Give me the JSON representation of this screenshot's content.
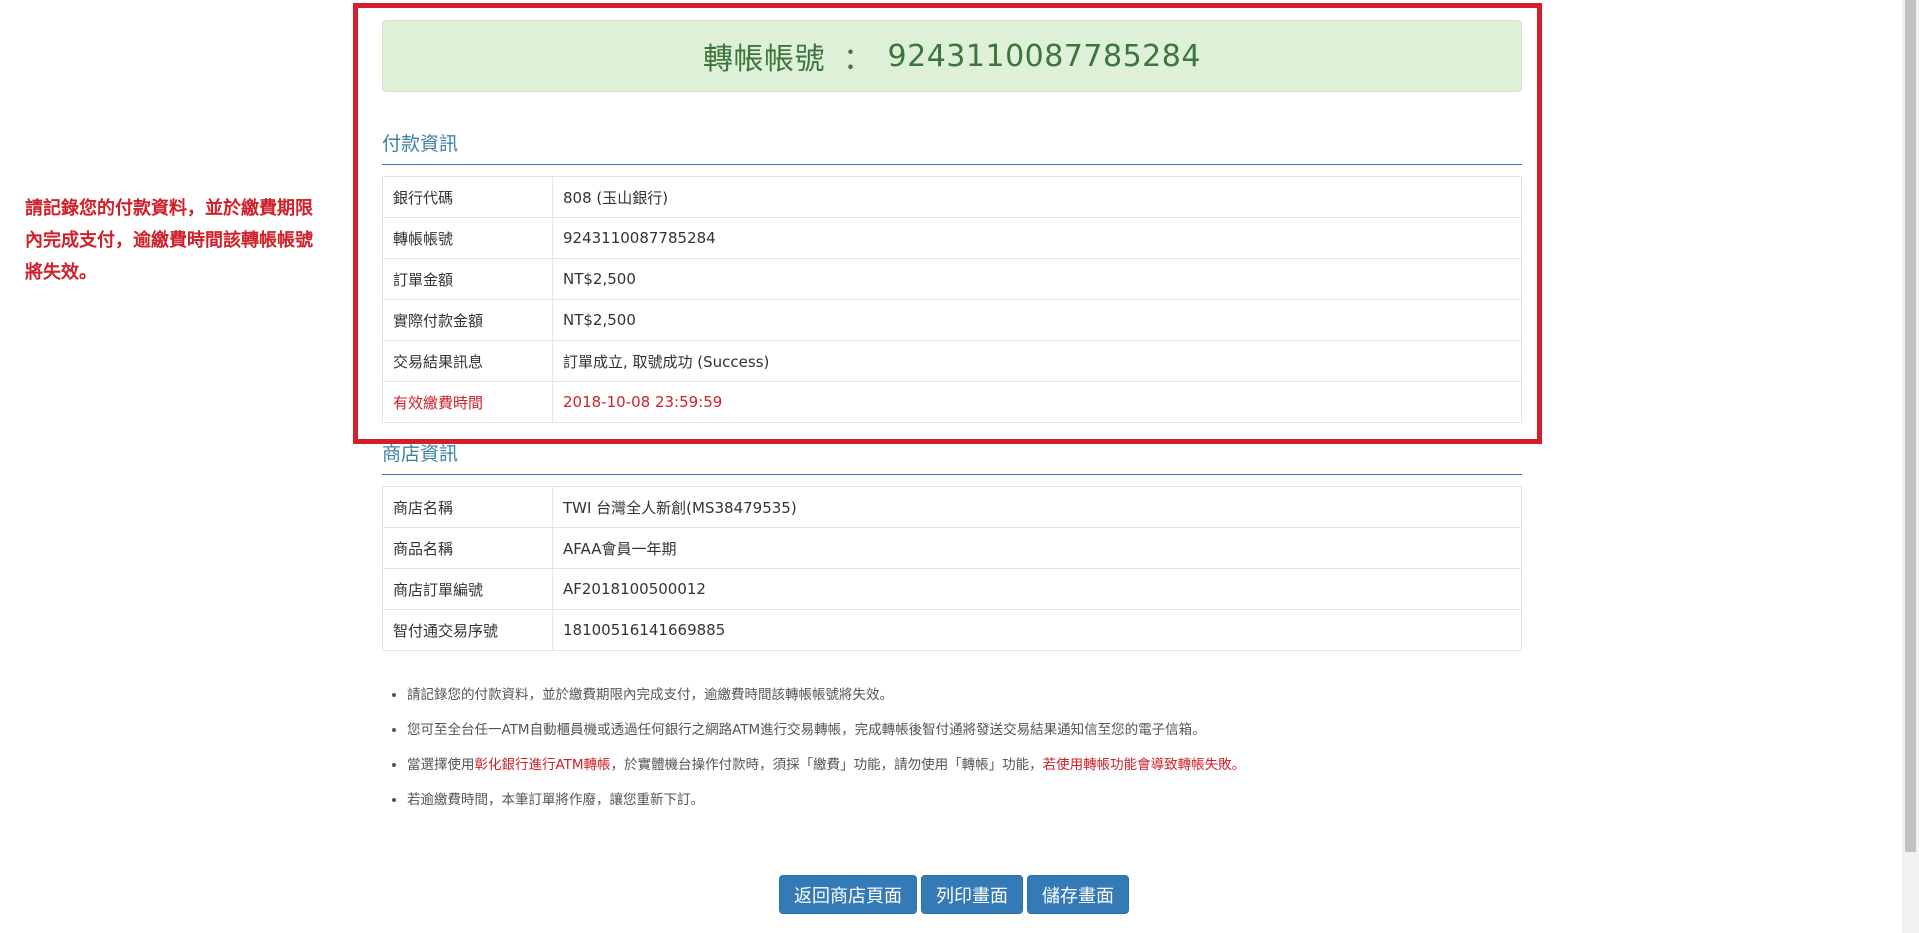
{
  "annotation": {
    "note": "請記錄您的付款資料，並於繳費期限內完成支付，逾繳費時間該轉帳帳號將失效。"
  },
  "banner": {
    "label": "轉帳帳號",
    "separator": "：",
    "account": "9243110087785284"
  },
  "payment_section": {
    "title": "付款資訊",
    "rows": [
      {
        "label": "銀行代碼",
        "value": "808 (玉山銀行)"
      },
      {
        "label": "轉帳帳號",
        "value": "9243110087785284"
      },
      {
        "label": "訂單金額",
        "value": "NT$2,500"
      },
      {
        "label": "實際付款金額",
        "value": "NT$2,500"
      },
      {
        "label": "交易結果訊息",
        "value": "訂單成立, 取號成功 (Success)"
      },
      {
        "label": "有效繳費時間",
        "value": "2018-10-08 23:59:59"
      }
    ]
  },
  "shop_section": {
    "title": "商店資訊",
    "rows": [
      {
        "label": "商店名稱",
        "value": "TWI 台灣全人新創(MS38479535)"
      },
      {
        "label": "商品名稱",
        "value": "AFAA會員一年期"
      },
      {
        "label": "商店訂單編號",
        "value": "AF2018100500012"
      },
      {
        "label": "智付通交易序號",
        "value": "18100516141669885"
      }
    ]
  },
  "notes": {
    "n1": "請記錄您的付款資料，並於繳費期限內完成支付，逾繳費時間該轉帳帳號將失效。",
    "n2": "您可至全台任一ATM自動櫃員機或透過任何銀行之網路ATM進行交易轉帳，完成轉帳後智付通將發送交易結果通知信至您的電子信箱。",
    "n3_a": "當選擇使用",
    "n3_b": "彰化銀行進行ATM轉帳",
    "n3_c": "，於實體機台操作付款時，須採「繳費」功能，請勿使用「轉帳」功能，",
    "n3_d": "若使用轉帳功能會導致轉帳失敗",
    "n3_e": "。",
    "n4": "若逾繳費時間，本筆訂單將作廢，讓您重新下訂。"
  },
  "buttons": {
    "back": "返回商店頁面",
    "print": "列印畫面",
    "save": "儲存畫面"
  },
  "colors": {
    "highlight_frame": "#d21f2b",
    "annotation_text": "#d0202a",
    "banner_bg": "#dff0d8",
    "banner_text": "#3c763d",
    "section_title": "#3a82a8",
    "button": "#337ab7"
  }
}
